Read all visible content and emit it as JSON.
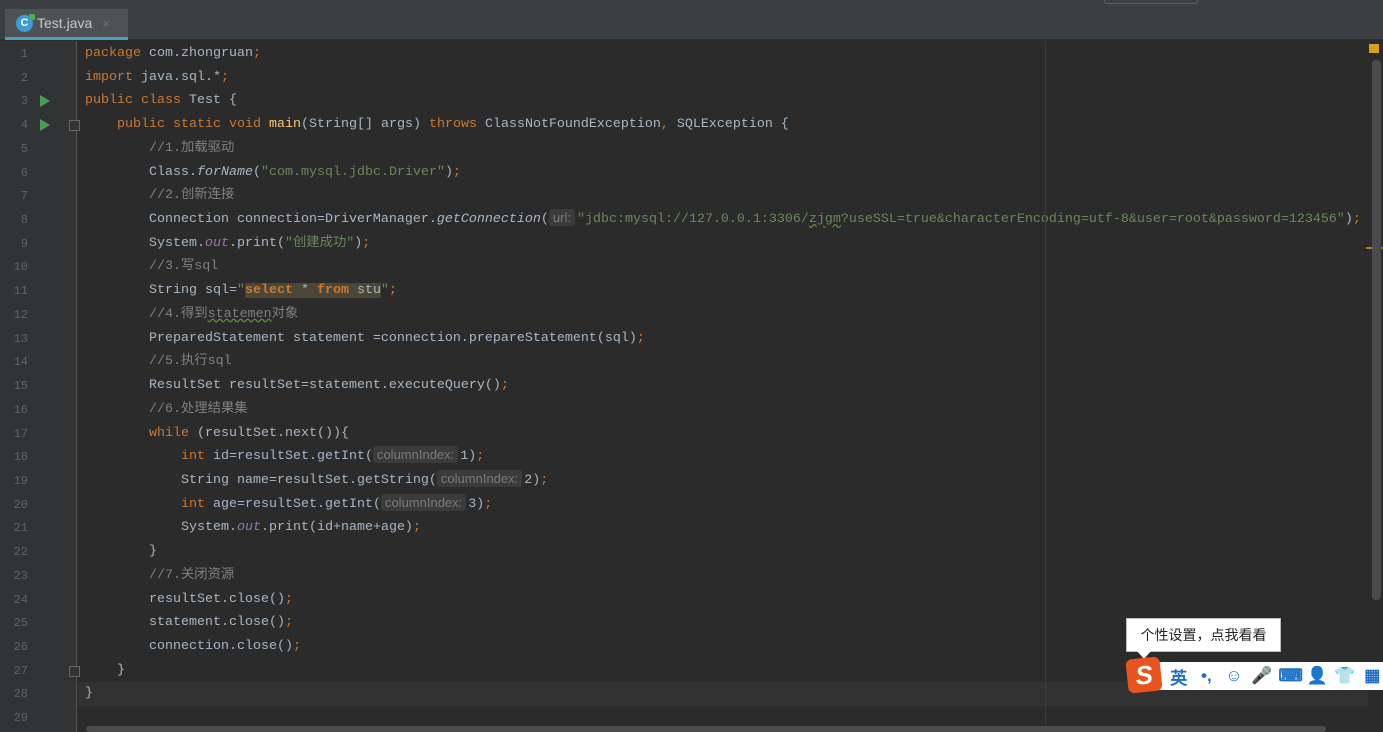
{
  "tab": {
    "label": "Test.java",
    "icon": "java-class-icon",
    "close": "×"
  },
  "colors": {
    "keyword": "#cc7832",
    "string": "#6a8759",
    "comment": "#808080",
    "method": "#ffc66d",
    "field": "#9876aa",
    "accent": "#4a9ebf"
  },
  "run_lines": [
    3,
    4
  ],
  "fold_lines": [
    4,
    27
  ],
  "current_line": 28,
  "lines": [
    [
      [
        "kw",
        "package "
      ],
      [
        "",
        "com.zhongruan"
      ],
      [
        "kw",
        ";"
      ]
    ],
    [
      [
        "kw",
        "import "
      ],
      [
        "",
        "java.sql.*"
      ],
      [
        "kw",
        ";"
      ]
    ],
    [
      [
        "kw",
        "public class "
      ],
      [
        "",
        "Test {"
      ]
    ],
    [
      [
        "",
        "    "
      ],
      [
        "kw",
        "public static void "
      ],
      [
        "mn",
        "main"
      ],
      [
        "",
        "(String[] args) "
      ],
      [
        "kw",
        "throws "
      ],
      [
        "",
        "ClassNotFoundException"
      ],
      [
        "kw",
        ", "
      ],
      [
        "",
        "SQLException {"
      ]
    ],
    [
      [
        "cm",
        "        //1.加载驱动"
      ]
    ],
    [
      [
        "",
        "        Class."
      ],
      [
        "it",
        "forName"
      ],
      [
        "",
        "("
      ],
      [
        "st",
        "\"com.mysql.jdbc.Driver\""
      ],
      [
        "",
        ")"
      ],
      [
        "kw",
        ";"
      ]
    ],
    [
      [
        "cm",
        "        //2.创新连接"
      ]
    ],
    [
      [
        "",
        "        Connection connection=DriverManager."
      ],
      [
        "it",
        "getConnection"
      ],
      [
        "",
        "("
      ],
      [
        "hint",
        "url:"
      ],
      [
        "st",
        "\"jdbc:mysql://127.0.0.1:3306/"
      ],
      [
        "stw",
        "zjgm"
      ],
      [
        "st",
        "?useSSL=true&characterEncoding=utf-8&user=root&password=123456\""
      ],
      [
        "",
        ")"
      ],
      [
        "kw",
        ";"
      ]
    ],
    [
      [
        "",
        "        System."
      ],
      [
        "fd",
        "out"
      ],
      [
        "",
        ".print("
      ],
      [
        "st",
        "\"创建成功\""
      ],
      [
        "",
        ")"
      ],
      [
        "kw",
        ";"
      ]
    ],
    [
      [
        "cm",
        "        //3.写sql"
      ]
    ],
    [
      [
        "",
        "        String sql="
      ],
      [
        "st",
        "\""
      ],
      [
        "hkb",
        "select"
      ],
      [
        "hst",
        " * "
      ],
      [
        "hkb",
        "from"
      ],
      [
        "hst",
        " stu"
      ],
      [
        "st",
        "\""
      ],
      [
        "kw",
        ";"
      ]
    ],
    [
      [
        "cm",
        "        //4.得到"
      ],
      [
        "cmw",
        "statemen"
      ],
      [
        "cm",
        "对象"
      ]
    ],
    [
      [
        "",
        "        PreparedStatement statement =connection.prepareStatement(sql)"
      ],
      [
        "kw",
        ";"
      ]
    ],
    [
      [
        "cm",
        "        //5.执行sql"
      ]
    ],
    [
      [
        "",
        "        ResultSet resultSet=statement.executeQuery()"
      ],
      [
        "kw",
        ";"
      ]
    ],
    [
      [
        "cm",
        "        //6.处理结果集"
      ]
    ],
    [
      [
        "kw",
        "        while "
      ],
      [
        "",
        "(resultSet.next()){"
      ]
    ],
    [
      [
        "kw",
        "            int "
      ],
      [
        "",
        "id=resultSet.getInt("
      ],
      [
        "hint",
        "columnIndex:"
      ],
      [
        "",
        "1)"
      ],
      [
        "kw",
        ";"
      ]
    ],
    [
      [
        "",
        "            String name=resultSet.getString("
      ],
      [
        "hint",
        "columnIndex:"
      ],
      [
        "",
        "2)"
      ],
      [
        "kw",
        ";"
      ]
    ],
    [
      [
        "kw",
        "            int "
      ],
      [
        "",
        "age=resultSet.getInt("
      ],
      [
        "hint",
        "columnIndex:"
      ],
      [
        "",
        "3)"
      ],
      [
        "kw",
        ";"
      ]
    ],
    [
      [
        "",
        "            System."
      ],
      [
        "fd",
        "out"
      ],
      [
        "",
        ".print(id+name+age)"
      ],
      [
        "kw",
        ";"
      ]
    ],
    [
      [
        "",
        "        }"
      ]
    ],
    [
      [
        "cm",
        "        //7.关闭资源"
      ]
    ],
    [
      [
        "",
        "        resultSet.close()"
      ],
      [
        "kw",
        ";"
      ]
    ],
    [
      [
        "",
        "        statement.close()"
      ],
      [
        "kw",
        ";"
      ]
    ],
    [
      [
        "",
        "        connection.close()"
      ],
      [
        "kw",
        ";"
      ]
    ],
    [
      [
        "",
        "    }"
      ]
    ],
    [
      [
        "",
        "}"
      ]
    ],
    [
      [
        "",
        ""
      ]
    ]
  ],
  "ime": {
    "tooltip": "个性设置，点我看看",
    "logo": "S",
    "items": [
      {
        "icon": "english-mode-icon",
        "label": "英"
      },
      {
        "icon": "punctuation-icon",
        "label": "•,"
      },
      {
        "icon": "emoji-icon",
        "label": "☺"
      },
      {
        "icon": "microphone-icon",
        "label": "🎤"
      },
      {
        "icon": "keyboard-icon",
        "label": "⌨"
      },
      {
        "icon": "user-icon",
        "label": "👤"
      },
      {
        "icon": "skin-icon",
        "label": "👕"
      },
      {
        "icon": "toolbox-icon",
        "label": "▦"
      }
    ]
  }
}
